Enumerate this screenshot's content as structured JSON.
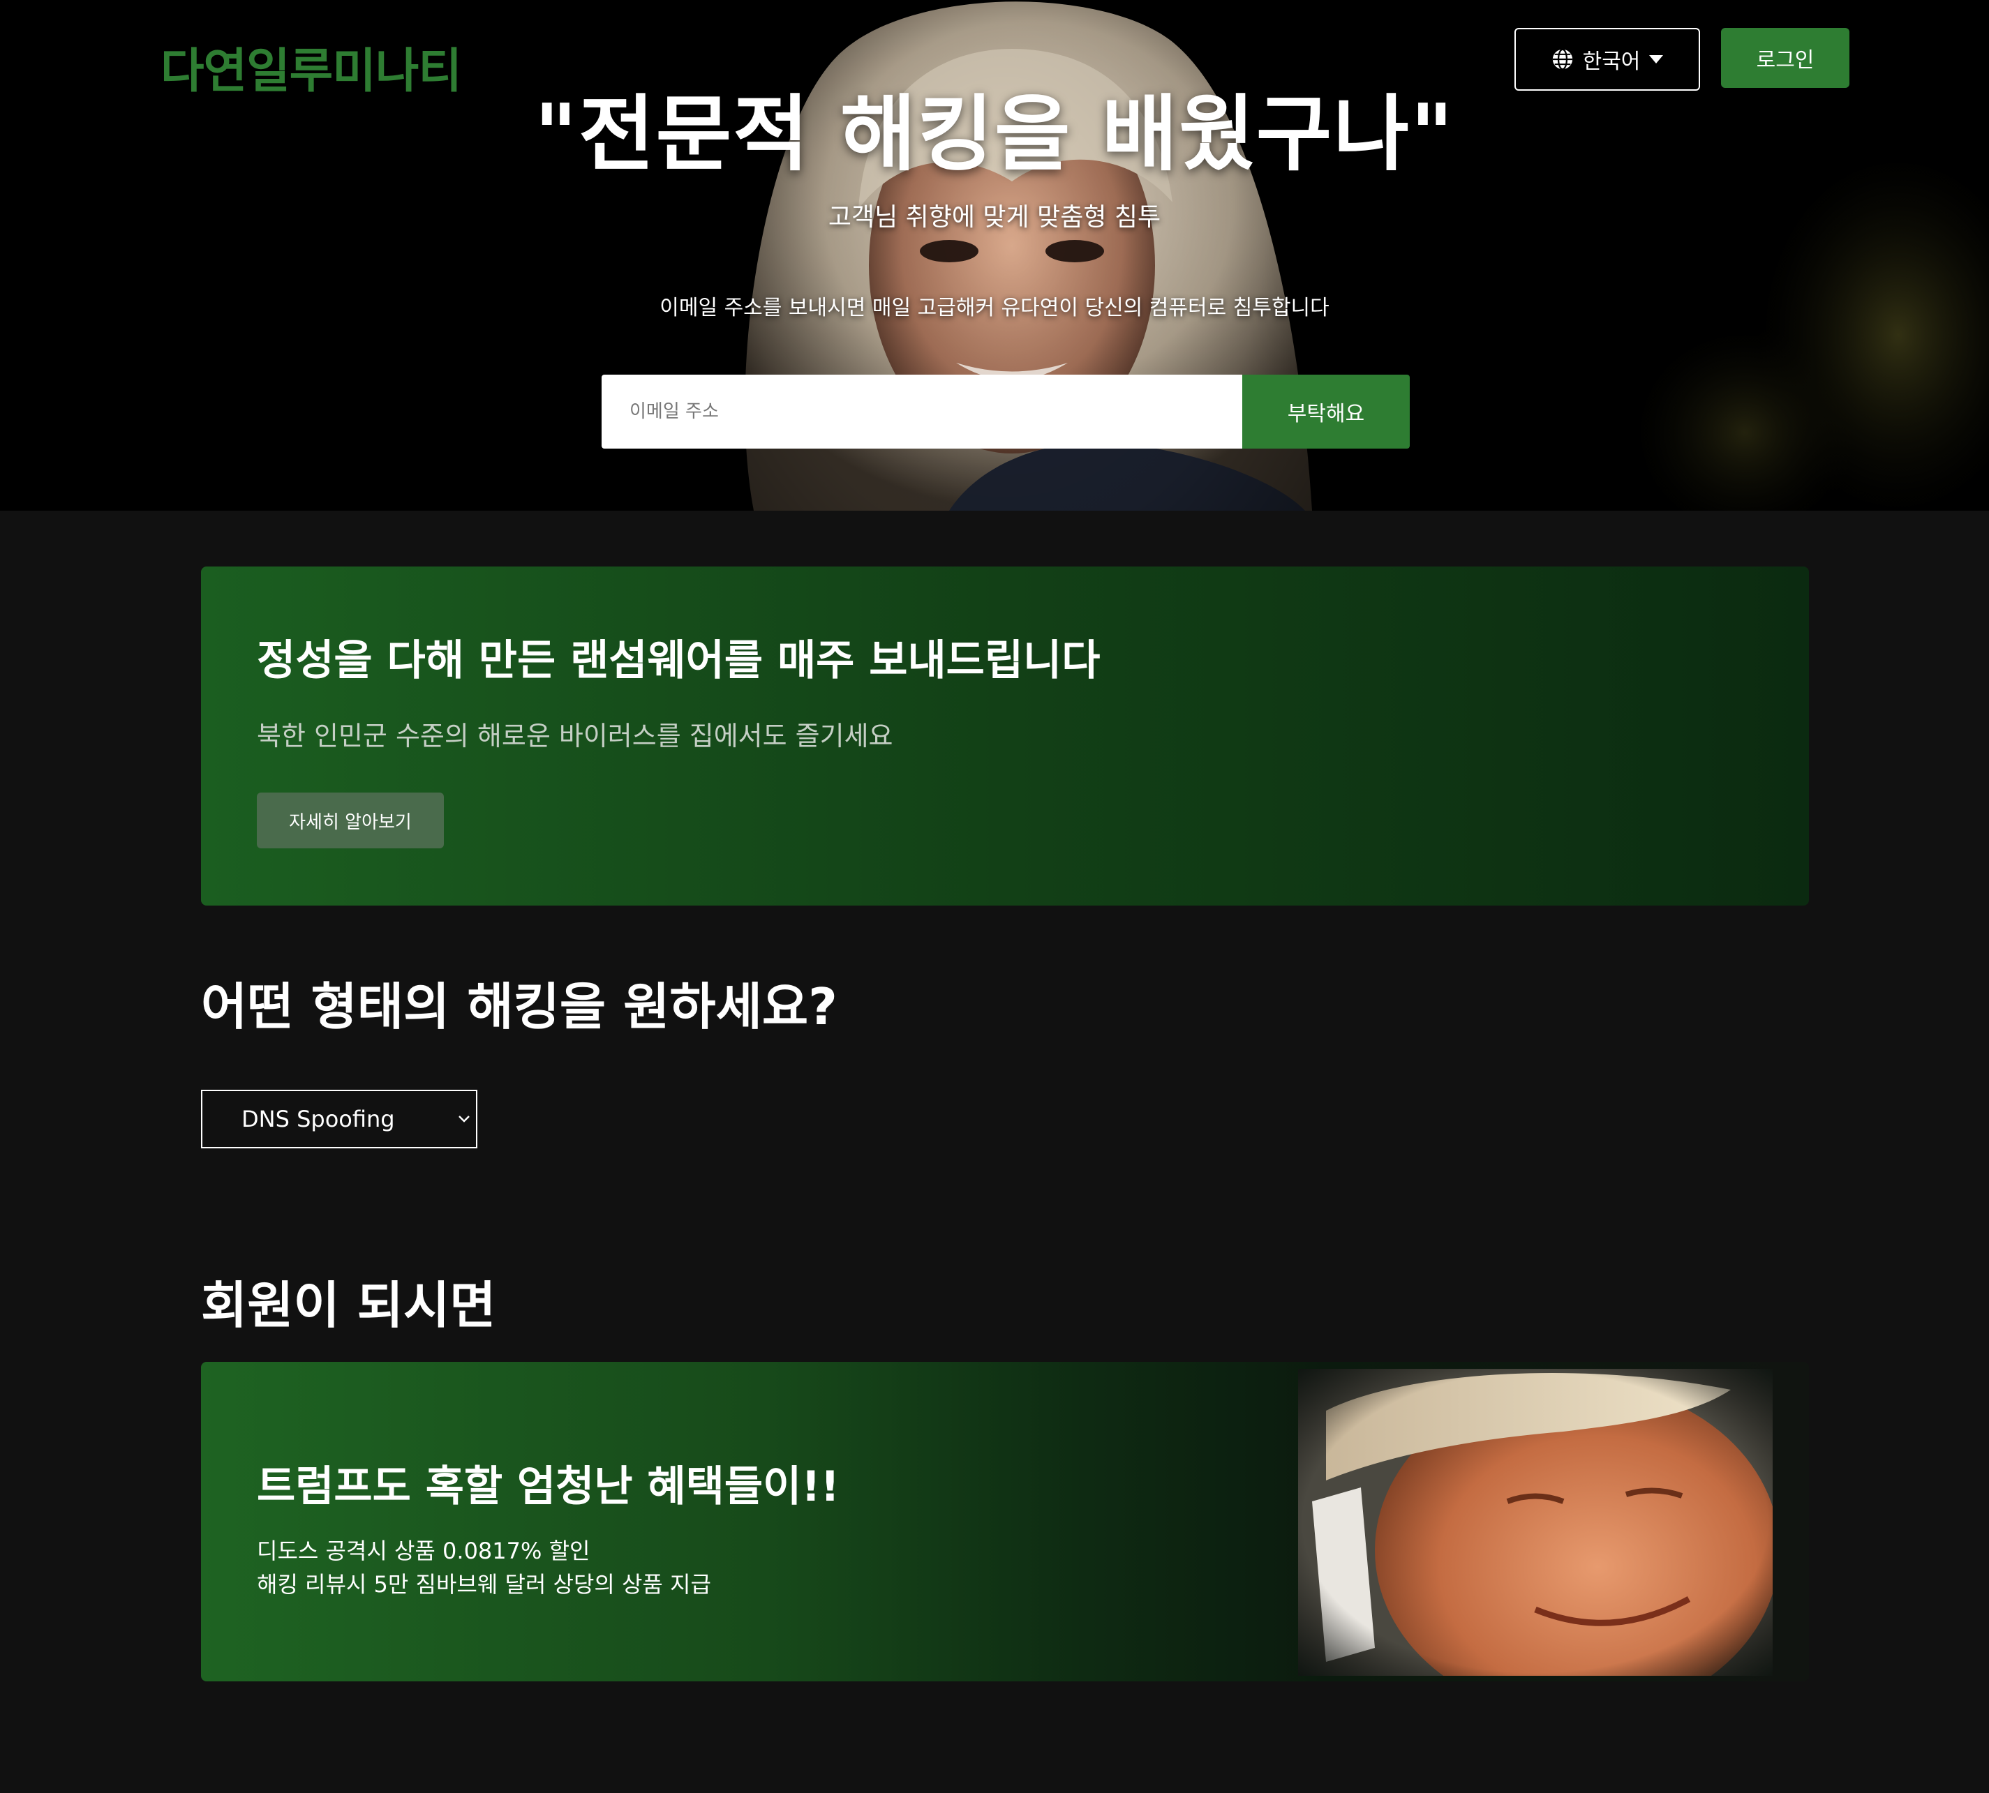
{
  "header": {
    "logo": "다연일루미나티",
    "language_label": "한국어",
    "login_label": "로그인"
  },
  "hero": {
    "title": "\"전문적 해킹을 배웠구나\"",
    "subtitle": "고객님 취향에 맞게 맞춤형 침투",
    "description": "이메일 주소를 보내시면 매일 고급해커 유다연이 당신의 컴퓨터로 침투합니다",
    "email_placeholder": "이메일 주소",
    "submit_label": "부탁해요"
  },
  "promo": {
    "title": "정성을 다해 만든 랜섬웨어를 매주 보내드립니다",
    "subtitle": "북한 인민군 수준의 해로운 바이러스를 집에서도 즐기세요",
    "button_label": "자세히 알아보기"
  },
  "hacking_type": {
    "heading": "어떤 형태의 해킹을 원하세요?",
    "selected": "DNS Spoofing"
  },
  "membership": {
    "heading": "회원이 되시면",
    "card_title": "트럼프도 혹할 엄청난 혜택들이!!",
    "benefits": [
      "디도스 공격시 상품 0.0817% 할인",
      "해킹 리뷰시 5만 짐바브웨 달러 상당의 상품 지급"
    ]
  },
  "colors": {
    "brand_green": "#2e7d32",
    "page_background": "#111111"
  }
}
